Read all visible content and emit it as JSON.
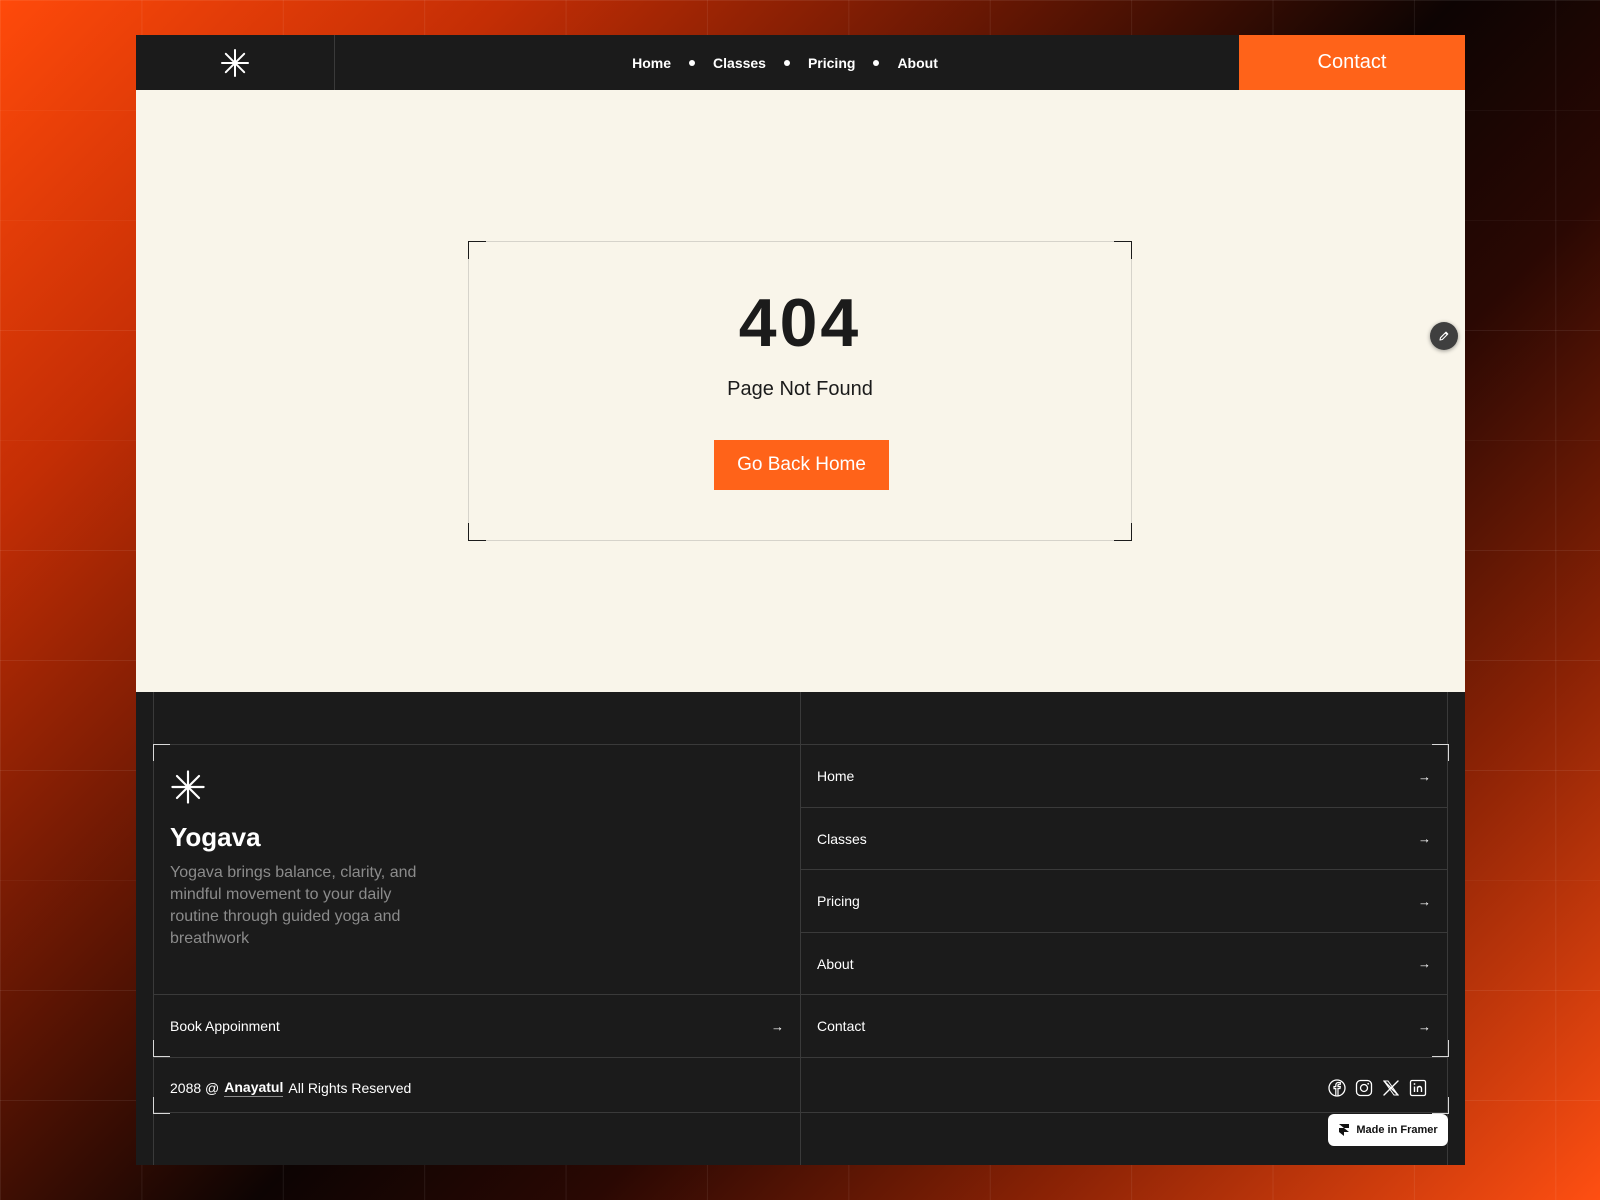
{
  "nav": {
    "links": [
      "Home",
      "Classes",
      "Pricing",
      "About"
    ],
    "contact_label": "Contact"
  },
  "error": {
    "code": "404",
    "message": "Page Not Found",
    "button_label": "Go Back Home"
  },
  "footer": {
    "brand": "Yogava",
    "description": "Yogava brings balance, clarity, and mindful movement to your daily routine through guided yoga and breathwork",
    "book_label": "Book Appoinment",
    "links": [
      "Home",
      "Classes",
      "Pricing",
      "About",
      "Contact"
    ],
    "copyright_prefix": "2088 @",
    "copyright_name": "Anayatul",
    "copyright_suffix": "All Rights Reserved",
    "socials": [
      "facebook-icon",
      "instagram-icon",
      "x-icon",
      "linkedin-icon"
    ],
    "framer_badge": "Made in Framer"
  },
  "colors": {
    "accent": "#ff6319",
    "dark": "#1b1b1b",
    "cream": "#f9f5ea"
  }
}
